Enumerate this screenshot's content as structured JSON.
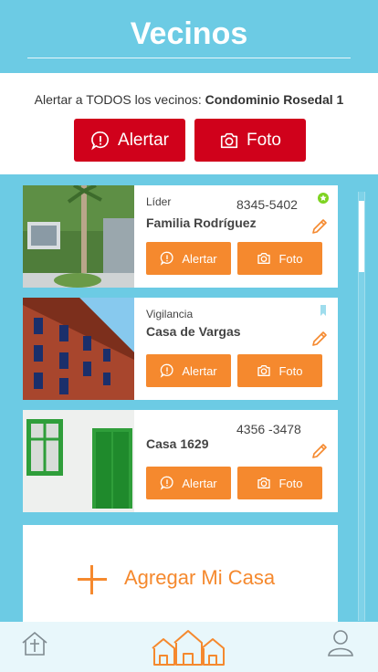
{
  "header": {
    "title": "Vecinos"
  },
  "alert_all": {
    "prefix": "Alertar a TODOS los vecinos: ",
    "condominium": "Condominio Rosedal 1",
    "alert_label": "Alertar",
    "photo_label": "Foto"
  },
  "houses": [
    {
      "role": "Líder",
      "name": "Familia Rodríguez",
      "phone": "8345-5402",
      "alert_label": "Alertar",
      "photo_label": "Foto",
      "marker": "leader-star-badge"
    },
    {
      "role": "Vigilancia",
      "name": "Casa de Vargas",
      "phone": "",
      "alert_label": "Alertar",
      "photo_label": "Foto",
      "marker": "bookmark-icon"
    },
    {
      "role": "",
      "name": "Casa 1629",
      "phone": "4356 -3478",
      "alert_label": "Alertar",
      "photo_label": "Foto",
      "marker": ""
    }
  ],
  "add_house": {
    "label": "Agregar Mi Casa"
  },
  "tabbar": {
    "tabs": [
      "church-icon",
      "neighborhood-icon",
      "profile-icon"
    ]
  },
  "colors": {
    "accent": "#6ccbe4",
    "alert_red": "#d0011b",
    "orange": "#f5892e",
    "leader_green": "#7ed321"
  }
}
